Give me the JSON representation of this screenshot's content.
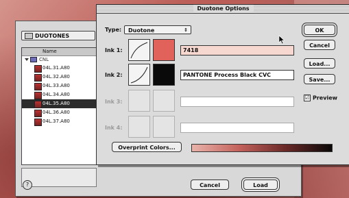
{
  "dialog": {
    "title": "Duotone Options",
    "type_label": "Type:",
    "type_value": "Duotone",
    "overprint_label": "Overprint Colors...",
    "preview_label": "Preview",
    "preview_checked": "☑",
    "buttons": {
      "ok": "OK",
      "cancel": "Cancel",
      "load": "Load...",
      "save": "Save..."
    },
    "inks": [
      {
        "label": "Ink 1:",
        "color": "#e0625a",
        "name": "7418",
        "field_bg": "#f7d8d0",
        "enabled": true
      },
      {
        "label": "Ink 2:",
        "color": "#0a0a0a",
        "name": "PANTONE Process Black CVC",
        "field_bg": "#ffffff",
        "enabled": true
      },
      {
        "label": "Ink 3:",
        "color": "",
        "name": "",
        "field_bg": "#ffffff",
        "enabled": false
      },
      {
        "label": "Ink 4:",
        "color": "",
        "name": "",
        "field_bg": "#ffffff",
        "enabled": false
      }
    ],
    "ramp_colors": [
      "#e8b3aa",
      "#c4625c",
      "#6a2a28",
      "#0a0808"
    ]
  },
  "back_window": {
    "folder": "DUOTONES",
    "list_header": "Name",
    "root_item": "CNL",
    "files": [
      "04L.31.A80",
      "04L.32.A80",
      "04L.33.A80",
      "04L.34.A80",
      "04L.35.A80",
      "04L.36.A80",
      "04L.37.A80"
    ],
    "selected_index": 4,
    "help_icon": "?",
    "cancel_label": "Cancel",
    "load_label": "Load"
  }
}
